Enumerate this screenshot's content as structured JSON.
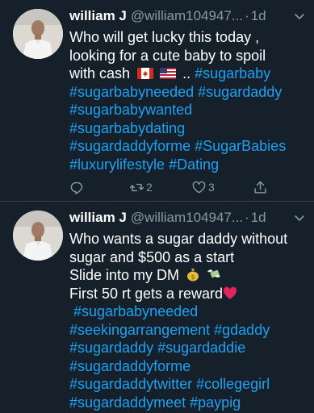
{
  "tweets": [
    {
      "name": "william J",
      "handle": "@william104947...",
      "separator": "·",
      "time": "1d",
      "lines": [
        {
          "text": "Who will get lucky this today ,"
        },
        {
          "text": "looking for a cute baby to spoil"
        },
        {
          "prefix": "with cash",
          "flags": [
            "canada-flag",
            "usa-flag"
          ],
          "mid": "..",
          "tag": "#sugarbaby"
        },
        {
          "tags": [
            "#sugarbabyneeded",
            "#sugardaddy"
          ]
        },
        {
          "tags": [
            "#sugarbabywanted"
          ]
        },
        {
          "tags": [
            "#sugarbabydating"
          ]
        },
        {
          "tags": [
            "#sugardaddyforme",
            "#SugarBabies"
          ]
        },
        {
          "tags": [
            "#luxurylifestyle",
            "#Dating"
          ]
        }
      ],
      "actions": {
        "reply_icon": "reply-icon",
        "retweet_icon": "retweet-icon",
        "retweet_count": "2",
        "like_icon": "like-icon",
        "like_count": "3",
        "share_icon": "share-icon"
      }
    },
    {
      "name": "william J",
      "handle": "@william104947...",
      "separator": "·",
      "time": "1d",
      "lines": [
        {
          "text": "Who wants a sugar daddy without"
        },
        {
          "text": "sugar and $500 as a start"
        },
        {
          "text": "Slide into my DM",
          "emojis": [
            "money-bag-emoji",
            "money-wings-emoji"
          ]
        },
        {
          "text": "First 50 rt gets a reward",
          "emojis": [
            "heart-emoji"
          ]
        },
        {
          "tags": [
            "#sugarbabyneeded"
          ],
          "indent": true
        },
        {
          "tags": [
            "#seekingarrangement",
            "#gdaddy"
          ]
        },
        {
          "tags": [
            "#sugardaddy",
            "#sugardaddie"
          ]
        },
        {
          "tags": [
            "#sugardaddyforme"
          ]
        },
        {
          "tags": [
            "#sugardaddytwitter",
            "#collegegirl"
          ]
        },
        {
          "tags": [
            "#sugardaddymeet",
            "#paypig"
          ]
        }
      ]
    }
  ],
  "colors": {
    "background": "#15202b",
    "text": "#ffffff",
    "secondary": "#8899a6",
    "hashtag": "#1da1f2",
    "divider": "#38444d"
  }
}
